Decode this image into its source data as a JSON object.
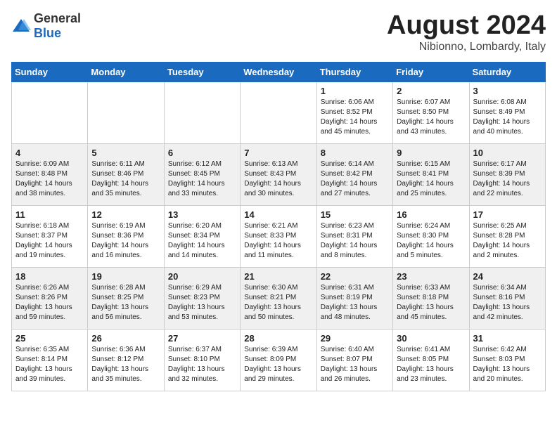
{
  "logo": {
    "general": "General",
    "blue": "Blue"
  },
  "title": {
    "month_year": "August 2024",
    "location": "Nibionno, Lombardy, Italy"
  },
  "weekdays": [
    "Sunday",
    "Monday",
    "Tuesday",
    "Wednesday",
    "Thursday",
    "Friday",
    "Saturday"
  ],
  "weeks": [
    [
      {
        "day": "",
        "text": ""
      },
      {
        "day": "",
        "text": ""
      },
      {
        "day": "",
        "text": ""
      },
      {
        "day": "",
        "text": ""
      },
      {
        "day": "1",
        "text": "Sunrise: 6:06 AM\nSunset: 8:52 PM\nDaylight: 14 hours\nand 45 minutes."
      },
      {
        "day": "2",
        "text": "Sunrise: 6:07 AM\nSunset: 8:50 PM\nDaylight: 14 hours\nand 43 minutes."
      },
      {
        "day": "3",
        "text": "Sunrise: 6:08 AM\nSunset: 8:49 PM\nDaylight: 14 hours\nand 40 minutes."
      }
    ],
    [
      {
        "day": "4",
        "text": "Sunrise: 6:09 AM\nSunset: 8:48 PM\nDaylight: 14 hours\nand 38 minutes."
      },
      {
        "day": "5",
        "text": "Sunrise: 6:11 AM\nSunset: 8:46 PM\nDaylight: 14 hours\nand 35 minutes."
      },
      {
        "day": "6",
        "text": "Sunrise: 6:12 AM\nSunset: 8:45 PM\nDaylight: 14 hours\nand 33 minutes."
      },
      {
        "day": "7",
        "text": "Sunrise: 6:13 AM\nSunset: 8:43 PM\nDaylight: 14 hours\nand 30 minutes."
      },
      {
        "day": "8",
        "text": "Sunrise: 6:14 AM\nSunset: 8:42 PM\nDaylight: 14 hours\nand 27 minutes."
      },
      {
        "day": "9",
        "text": "Sunrise: 6:15 AM\nSunset: 8:41 PM\nDaylight: 14 hours\nand 25 minutes."
      },
      {
        "day": "10",
        "text": "Sunrise: 6:17 AM\nSunset: 8:39 PM\nDaylight: 14 hours\nand 22 minutes."
      }
    ],
    [
      {
        "day": "11",
        "text": "Sunrise: 6:18 AM\nSunset: 8:37 PM\nDaylight: 14 hours\nand 19 minutes."
      },
      {
        "day": "12",
        "text": "Sunrise: 6:19 AM\nSunset: 8:36 PM\nDaylight: 14 hours\nand 16 minutes."
      },
      {
        "day": "13",
        "text": "Sunrise: 6:20 AM\nSunset: 8:34 PM\nDaylight: 14 hours\nand 14 minutes."
      },
      {
        "day": "14",
        "text": "Sunrise: 6:21 AM\nSunset: 8:33 PM\nDaylight: 14 hours\nand 11 minutes."
      },
      {
        "day": "15",
        "text": "Sunrise: 6:23 AM\nSunset: 8:31 PM\nDaylight: 14 hours\nand 8 minutes."
      },
      {
        "day": "16",
        "text": "Sunrise: 6:24 AM\nSunset: 8:30 PM\nDaylight: 14 hours\nand 5 minutes."
      },
      {
        "day": "17",
        "text": "Sunrise: 6:25 AM\nSunset: 8:28 PM\nDaylight: 14 hours\nand 2 minutes."
      }
    ],
    [
      {
        "day": "18",
        "text": "Sunrise: 6:26 AM\nSunset: 8:26 PM\nDaylight: 13 hours\nand 59 minutes."
      },
      {
        "day": "19",
        "text": "Sunrise: 6:28 AM\nSunset: 8:25 PM\nDaylight: 13 hours\nand 56 minutes."
      },
      {
        "day": "20",
        "text": "Sunrise: 6:29 AM\nSunset: 8:23 PM\nDaylight: 13 hours\nand 53 minutes."
      },
      {
        "day": "21",
        "text": "Sunrise: 6:30 AM\nSunset: 8:21 PM\nDaylight: 13 hours\nand 50 minutes."
      },
      {
        "day": "22",
        "text": "Sunrise: 6:31 AM\nSunset: 8:19 PM\nDaylight: 13 hours\nand 48 minutes."
      },
      {
        "day": "23",
        "text": "Sunrise: 6:33 AM\nSunset: 8:18 PM\nDaylight: 13 hours\nand 45 minutes."
      },
      {
        "day": "24",
        "text": "Sunrise: 6:34 AM\nSunset: 8:16 PM\nDaylight: 13 hours\nand 42 minutes."
      }
    ],
    [
      {
        "day": "25",
        "text": "Sunrise: 6:35 AM\nSunset: 8:14 PM\nDaylight: 13 hours\nand 39 minutes."
      },
      {
        "day": "26",
        "text": "Sunrise: 6:36 AM\nSunset: 8:12 PM\nDaylight: 13 hours\nand 35 minutes."
      },
      {
        "day": "27",
        "text": "Sunrise: 6:37 AM\nSunset: 8:10 PM\nDaylight: 13 hours\nand 32 minutes."
      },
      {
        "day": "28",
        "text": "Sunrise: 6:39 AM\nSunset: 8:09 PM\nDaylight: 13 hours\nand 29 minutes."
      },
      {
        "day": "29",
        "text": "Sunrise: 6:40 AM\nSunset: 8:07 PM\nDaylight: 13 hours\nand 26 minutes."
      },
      {
        "day": "30",
        "text": "Sunrise: 6:41 AM\nSunset: 8:05 PM\nDaylight: 13 hours\nand 23 minutes."
      },
      {
        "day": "31",
        "text": "Sunrise: 6:42 AM\nSunset: 8:03 PM\nDaylight: 13 hours\nand 20 minutes."
      }
    ]
  ]
}
